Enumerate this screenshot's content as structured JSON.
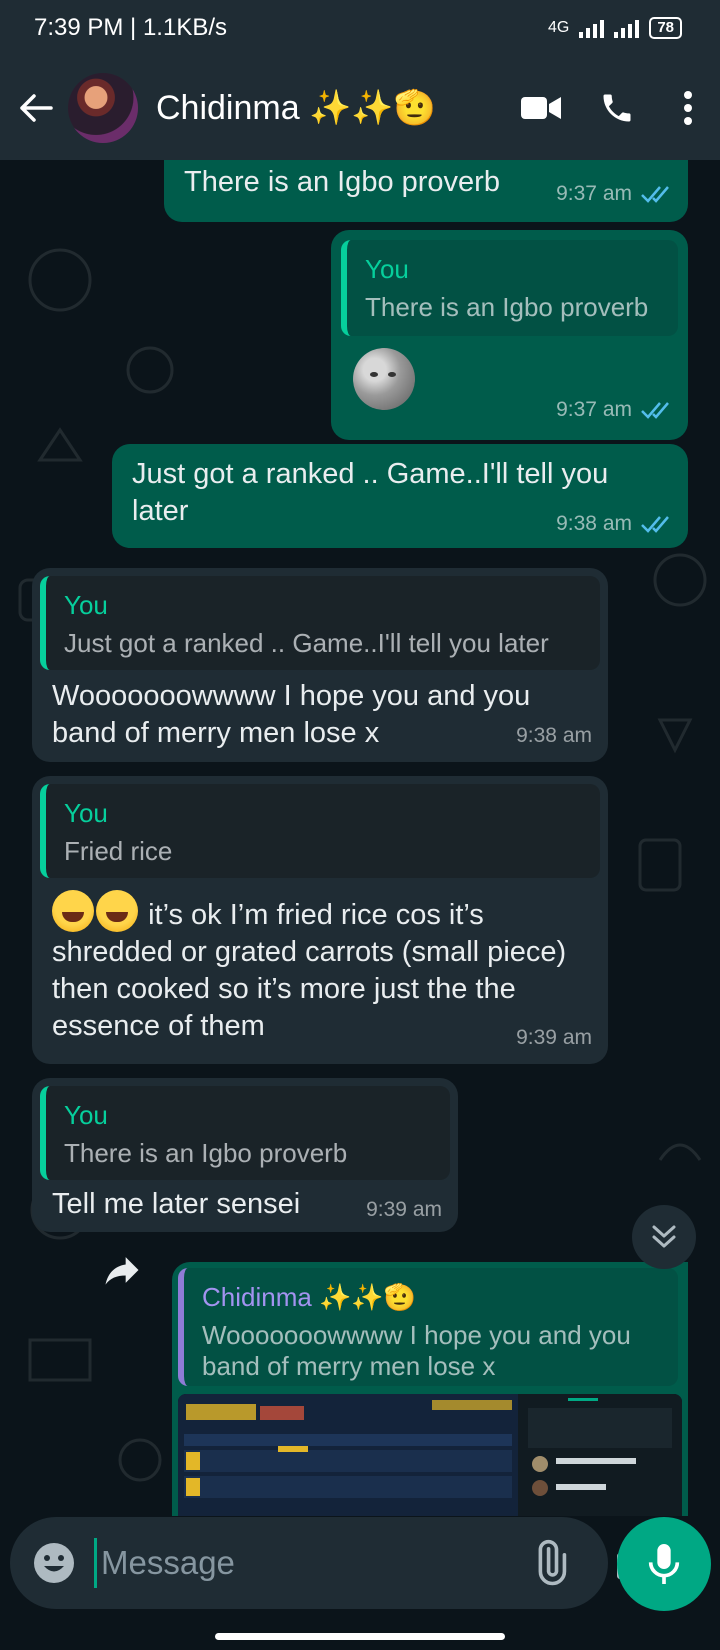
{
  "status_bar": {
    "time": "7:39 PM | 1.1KB/s",
    "network": "4G",
    "battery": "78"
  },
  "header": {
    "contact_name": "Chidinma ✨✨🫡"
  },
  "messages": [
    {
      "text": "There is an Igbo proverb",
      "time": "9:37 am"
    },
    {
      "quote_author": "You",
      "quote_text": "There is an Igbo proverb",
      "time": "9:37 am"
    },
    {
      "text": "Just got a ranked .. Game..I'll tell you later",
      "time": "9:38 am"
    },
    {
      "quote_author": "You",
      "quote_text": "Just got a ranked .. Game..I'll tell you later",
      "text": "Wooooooowwww I hope you and you band of merry men lose x",
      "time": "9:38 am"
    },
    {
      "quote_author": "You",
      "quote_text": "Fried rice",
      "text": "it’s ok I’m fried rice cos it’s shredded or grated carrots (small piece) then cooked so it’s more just the the essence of them",
      "time": "9:39 am"
    },
    {
      "quote_author": "You",
      "quote_text": "There is an Igbo proverb",
      "text": "Tell me later sensei",
      "time": "9:39 am"
    },
    {
      "quote_author": "Chidinma ✨✨🫡",
      "quote_text": "Wooooooowwww I hope you and you band of merry men lose x"
    }
  ],
  "input": {
    "placeholder": "Message"
  },
  "colors": {
    "outgoing": "#005c4b",
    "incoming": "#1f2c34",
    "accent": "#00a884",
    "read_ticks": "#53bdeb"
  }
}
